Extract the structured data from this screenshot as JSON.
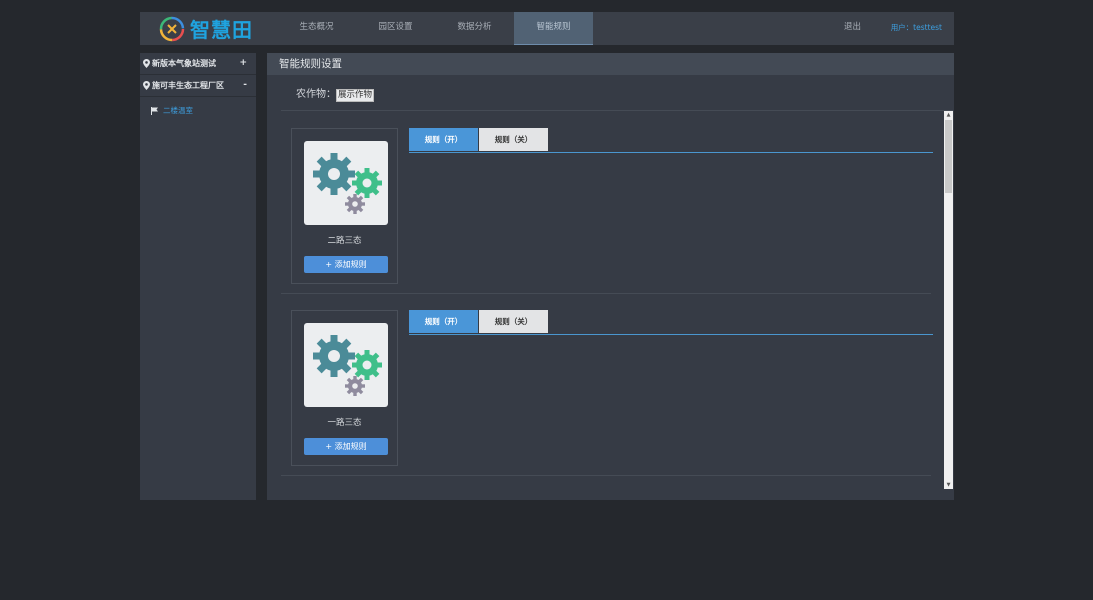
{
  "brand": {
    "name": "智慧田"
  },
  "nav": {
    "items": [
      {
        "label": "生态概况"
      },
      {
        "label": "园区设置"
      },
      {
        "label": "数据分析"
      },
      {
        "label": "智能规则",
        "active": true
      }
    ],
    "logout": "退出",
    "user": "用户：testtest"
  },
  "sidebar": {
    "groups": [
      {
        "label": "新版本气象站测试",
        "toggle": "+"
      },
      {
        "label": "施可丰生态工程厂区",
        "toggle": "-",
        "children": [
          {
            "label": "二楼温室"
          }
        ]
      }
    ]
  },
  "main": {
    "title": "智能规则设置",
    "crop_label": "农作物：",
    "crop_value": "展示作物",
    "devices": [
      {
        "name": "二路三态",
        "add_label": "+ 添加规则",
        "tab_on": "规则（开）",
        "tab_off": "规则（关）"
      },
      {
        "name": "一路三态",
        "add_label": "+ 添加规则",
        "tab_on": "规则（开）",
        "tab_off": "规则（关）"
      }
    ]
  },
  "colors": {
    "accent": "#4a96d8",
    "link": "#3d9fe0",
    "bg": "#25282d",
    "panel": "#363b45"
  }
}
